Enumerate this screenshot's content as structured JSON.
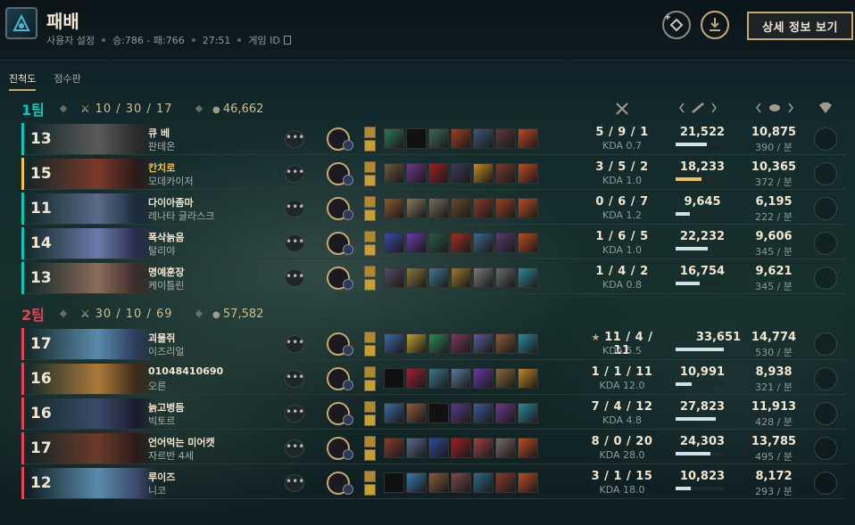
{
  "header": {
    "title": "패배",
    "meta": [
      "사용자 설정",
      "승:786 - 패:766",
      "27:51",
      "게임 ID"
    ],
    "detail_button": "상세 정보 보기"
  },
  "tabs": [
    "진척도",
    "점수판"
  ],
  "active_tab": 0,
  "colors": {
    "accent": "#c8aa6e",
    "team1": "#0ac8b9",
    "team2": "#e84057",
    "row_highlight": "#f0c34a"
  },
  "teams": [
    {
      "name": "1팀",
      "kda": "10 / 30 / 17",
      "gold": "46,662",
      "players": [
        {
          "level": "13",
          "name": "큐 베",
          "champion": "판테온",
          "kda": "5 / 9 / 1",
          "ratio": "KDA 0.7",
          "damage": "21,522",
          "damage_fraction": 0.64,
          "gold": "10,875",
          "gpm": "390 / 분",
          "highlight": false,
          "items": [
            "#2a7a5a",
            "#111",
            "#3a6a5a",
            "#a04020",
            "#3a5a7a",
            "#5a3a3a",
            "#c04a20"
          ]
        },
        {
          "level": "15",
          "name": "칸치로",
          "champion": "모데카이저",
          "kda": "3 / 5 / 2",
          "ratio": "KDA 1.0",
          "damage": "18,233",
          "damage_fraction": 0.54,
          "gold": "10,365",
          "gpm": "372 / 분",
          "highlight": true,
          "items": [
            "#6a5a3a",
            "#6a3a8a",
            "#a02020",
            "#3a3a5a",
            "#c08a20",
            "#7a3a2a",
            "#c04a20"
          ]
        },
        {
          "level": "11",
          "name": "다이아좀마",
          "champion": "레나타 글라스크",
          "kda": "0 / 6 / 7",
          "ratio": "KDA 1.2",
          "damage": "9,645",
          "damage_fraction": 0.29,
          "gold": "6,195",
          "gpm": "222 / 분",
          "highlight": false,
          "items": [
            "#8a5a2a",
            "#8a7a5a",
            "#7a6a5a",
            "#6a4a2a",
            "#8a3a2a",
            "#a04020",
            "#c04a20"
          ]
        },
        {
          "level": "14",
          "name": "폭삭늙음",
          "champion": "탈리야",
          "kda": "1 / 6 / 5",
          "ratio": "KDA 1.0",
          "damage": "22,232",
          "damage_fraction": 0.66,
          "gold": "9,606",
          "gpm": "345 / 분",
          "highlight": false,
          "items": [
            "#3a4aaa",
            "#6a3aaa",
            "#2a5a4a",
            "#a03020",
            "#3a6a8a",
            "#5a3a6a",
            "#c04a20"
          ]
        },
        {
          "level": "13",
          "name": "명예훈장",
          "champion": "케이틀린",
          "kda": "1 / 4 / 2",
          "ratio": "KDA 0.8",
          "damage": "16,754",
          "damage_fraction": 0.5,
          "gold": "9,621",
          "gpm": "345 / 분",
          "highlight": false,
          "items": [
            "#5a4a6a",
            "#8a7a3a",
            "#3a7a9a",
            "#9a7a2a",
            "#7a7a7a",
            "#6a6a6a",
            "#2a8a9a"
          ]
        }
      ]
    },
    {
      "name": "2팀",
      "kda": "30 / 10 / 69",
      "gold": "57,582",
      "players": [
        {
          "level": "17",
          "name": "괴물쥐",
          "champion": "이즈리얼",
          "kda": "11 / 4 / 11",
          "ratio": "KDA 5.5",
          "damage": "33,651",
          "damage_fraction": 1.0,
          "gold": "14,774",
          "gpm": "530 / 분",
          "highlight": false,
          "star": true,
          "items": [
            "#3a6aaa",
            "#c0a030",
            "#2a8a5a",
            "#7a3a5a",
            "#5a5a9a",
            "#8a5a3a",
            "#2a8a9a"
          ]
        },
        {
          "level": "16",
          "name": "01048410690",
          "champion": "오른",
          "kda": "1 / 1 / 11",
          "ratio": "KDA 12.0",
          "damage": "10,991",
          "damage_fraction": 0.33,
          "gold": "8,938",
          "gpm": "321 / 분",
          "highlight": false,
          "items": [
            "#111",
            "#a02030",
            "#3a7a8a",
            "#5a7a9a",
            "#6a3aaa",
            "#8a6a3a",
            "#c08a20"
          ]
        },
        {
          "level": "16",
          "name": "늙고병듬",
          "champion": "빅토르",
          "kda": "7 / 4 / 12",
          "ratio": "KDA 4.8",
          "damage": "27,823",
          "damage_fraction": 0.83,
          "gold": "11,913",
          "gpm": "428 / 분",
          "highlight": false,
          "items": [
            "#3a6aaa",
            "#8a5a3a",
            "#111",
            "#5a3a8a",
            "#3a5a9a",
            "#6a3a8a",
            "#2a8a9a"
          ]
        },
        {
          "level": "17",
          "name": "언어먹는 미어캣",
          "champion": "자르반 4세",
          "kda": "8 / 0 / 20",
          "ratio": "KDA 28.0",
          "damage": "24,303",
          "damage_fraction": 0.72,
          "gold": "13,785",
          "gpm": "495 / 분",
          "highlight": false,
          "items": [
            "#8a3a2a",
            "#5a6a8a",
            "#2a4a9a",
            "#a02020",
            "#a04040",
            "#7a6a6a",
            "#c04a20"
          ]
        },
        {
          "level": "12",
          "name": "루이즈",
          "champion": "니코",
          "kda": "3 / 1 / 15",
          "ratio": "KDA 18.0",
          "damage": "10,823",
          "damage_fraction": 0.32,
          "gold": "8,172",
          "gpm": "293 / 분",
          "highlight": false,
          "items": [
            "#111",
            "#3a7aaa",
            "#8a5a3a",
            "#7a4a4a",
            "#2a6a8a",
            "#8a3a2a",
            "#c04a20"
          ]
        }
      ]
    }
  ]
}
